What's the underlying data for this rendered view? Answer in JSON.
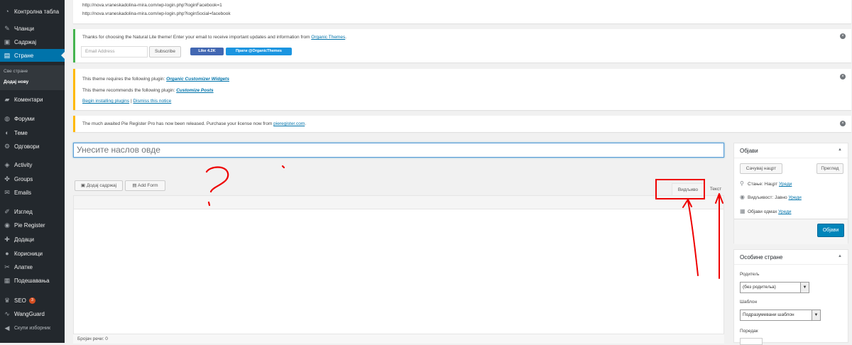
{
  "sidebar": {
    "items": [
      {
        "label": "Контролна табла",
        "icon": "dashboard-icon",
        "glyph": "◔"
      },
      {
        "label": "Чланци",
        "icon": "pin-icon",
        "glyph": "✎"
      },
      {
        "label": "Садржај",
        "icon": "media-icon",
        "glyph": "▣"
      },
      {
        "label": "Стране",
        "icon": "pages-icon",
        "glyph": "▤"
      },
      {
        "label": "Коментари",
        "icon": "comments-icon",
        "glyph": "▰"
      },
      {
        "label": "Форуми",
        "icon": "forums-icon",
        "glyph": "◍"
      },
      {
        "label": "Теме",
        "icon": "topics-icon",
        "glyph": "◐"
      },
      {
        "label": "Одговори",
        "icon": "replies-icon",
        "glyph": "⚙"
      },
      {
        "label": "Activity",
        "icon": "activity-icon",
        "glyph": "◈"
      },
      {
        "label": "Groups",
        "icon": "groups-icon",
        "glyph": "✤"
      },
      {
        "label": "Emails",
        "icon": "emails-icon",
        "glyph": "✉"
      },
      {
        "label": "Изглед",
        "icon": "appearance-icon",
        "glyph": "✐"
      },
      {
        "label": "Pie Register",
        "icon": "pie-register-icon",
        "glyph": "◉"
      },
      {
        "label": "Додаци",
        "icon": "plugins-icon",
        "glyph": "✚"
      },
      {
        "label": "Корисници",
        "icon": "users-icon",
        "glyph": "●"
      },
      {
        "label": "Алатке",
        "icon": "tools-icon",
        "glyph": "✂"
      },
      {
        "label": "Подешавања",
        "icon": "settings-icon",
        "glyph": "▦"
      },
      {
        "label": "SEO",
        "icon": "seo-icon",
        "glyph": "♛",
        "badge": "3"
      },
      {
        "label": "WangGuard",
        "icon": "wangguard-icon",
        "glyph": "∿"
      },
      {
        "label": "Скупи изборник",
        "icon": "collapse-icon",
        "glyph": "◀"
      }
    ],
    "submenu": [
      "Све стране",
      "Додај нову"
    ]
  },
  "notices": {
    "login_urls": [
      "http://nova.vraneskadolina-mira.com/wp-login.php?loginFacebook=1",
      "http://nova.vraneskadolina-mira.com/wp-login.php?loginSocial=facebook"
    ],
    "natural_lite": {
      "text": "Thanks for choosing the Natural Lite theme! Enter your email to receive important updates and information from ",
      "link": "Organic Themes",
      "text_end": ".",
      "email_placeholder": "Email Address",
      "subscribe": "Subscribe",
      "fb_like": "Like 4.2K",
      "twitter": "Прати @OrganicThemes"
    },
    "plugins": {
      "requires_text": "This theme requires the following plugin: ",
      "requires_link": "Organic Customizer Widgets",
      "recommends_text": "This theme recommends the following plugin: ",
      "recommends_link": "Customize Posts",
      "begin": "Begin installing plugins",
      "separator": " | ",
      "dismiss": "Dismiss this notice"
    },
    "pie": {
      "text": "The much awaited Pie Register Pro has now been released. Purchase your license now from ",
      "link": "pieregister.com",
      "text_end": "."
    },
    "close": "×"
  },
  "editor": {
    "title_placeholder": "Унесите наслов овде",
    "add_media": "Додај садржај",
    "add_form": "Add Form",
    "tab_visual": "Видљиво",
    "tab_text": "Текст",
    "word_count": "Бројач речи: 0"
  },
  "publish": {
    "title": "Објави",
    "save_draft": "Сачувај нацрт",
    "preview": "Преглед",
    "status_label": "Стање: Нацрт ",
    "visibility_label": "Видљивост: Јавно ",
    "publish_when": "Објави одмах ",
    "edit": "Уреди",
    "publish_button": "Објави"
  },
  "attributes": {
    "title": "Особине стране",
    "parent_label": "Родитељ",
    "parent_value": "(без родитеља)",
    "template_label": "Шаблон",
    "template_value": "Подразумевани шаблон",
    "order_label": "Поредак"
  },
  "colors": {
    "accent": "#0073aa",
    "annotation": "#e00000",
    "sidebar": "#23282d"
  }
}
